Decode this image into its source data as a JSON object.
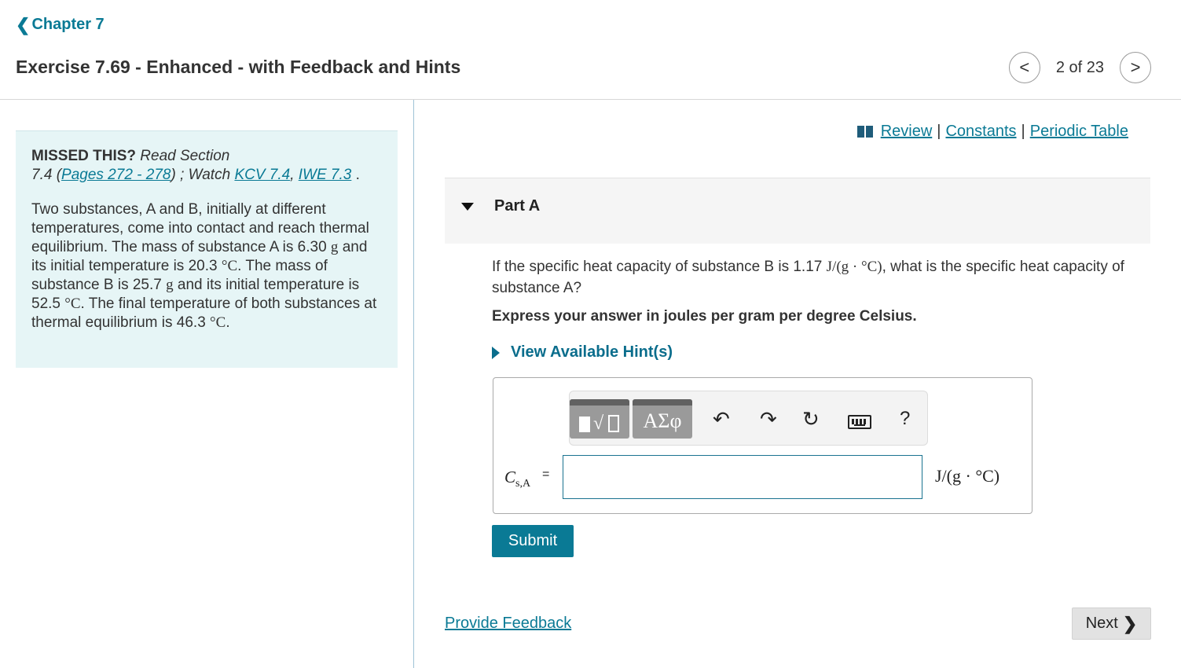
{
  "header": {
    "chapter_chevron": "❮",
    "chapter_label": "Chapter 7",
    "exercise_title": "Exercise 7.69 - Enhanced - with Feedback and Hints",
    "prev_icon": "<",
    "next_icon": ">",
    "pager_text": "2 of 23"
  },
  "info": {
    "missed_label": "MISSED THIS?",
    "read_section_text": "Read Section",
    "section_num": "7.4 (",
    "pages_link": "Pages 272 - 278",
    "watch_text": ") ; Watch",
    "kcv_link": "KCV 7.4",
    "comma": ",",
    "iwe_link": "IWE 7.3",
    "period": ".",
    "p_intro": "Two substances, A and B, initially at different temperatures, come into contact and reach thermal equilibrium. The mass of substance A is 6.30",
    "unit_g": "g",
    "p_and": "and its initial temperature is 20.3",
    "unit_c": "°C",
    "p_massb": ". The mass of substance B is 25.7",
    "p_tempb": "and its initial temperature is 52.5",
    "p_final": ". The final temperature of both substances at thermal equilibrium is 46.3",
    "p_end": "."
  },
  "resources": {
    "icon": "book-icon",
    "review": "Review",
    "separator": "|",
    "constants": "Constants",
    "periodic_table": "Periodic Table"
  },
  "part": {
    "title": "Part A",
    "question_pre": "If the specific heat capacity of substance B is 1.17",
    "question_unit": "J/(g · °C)",
    "question_post": ", what is the specific heat capacity of substance A?",
    "instruction": "Express your answer in joules per gram per degree Celsius.",
    "hints_label": "View Available Hint(s)"
  },
  "toolbar": {
    "templates_sqrt": "√",
    "greek": "ΑΣφ",
    "undo": "↶",
    "redo": "↷",
    "reset": "↻",
    "help": "?"
  },
  "answer": {
    "var_main": "C",
    "var_sub": "s,A",
    "equals": "=",
    "value": "",
    "unit": "J/(g · °C)"
  },
  "buttons": {
    "submit": "Submit",
    "feedback": "Provide Feedback",
    "next": "Next",
    "next_chevron": "❯"
  },
  "colors": {
    "link": "#0a7a95",
    "info_bg": "#e6f5f6",
    "submit_bg": "#0a7a95",
    "next_bg": "#e2e2e2"
  }
}
